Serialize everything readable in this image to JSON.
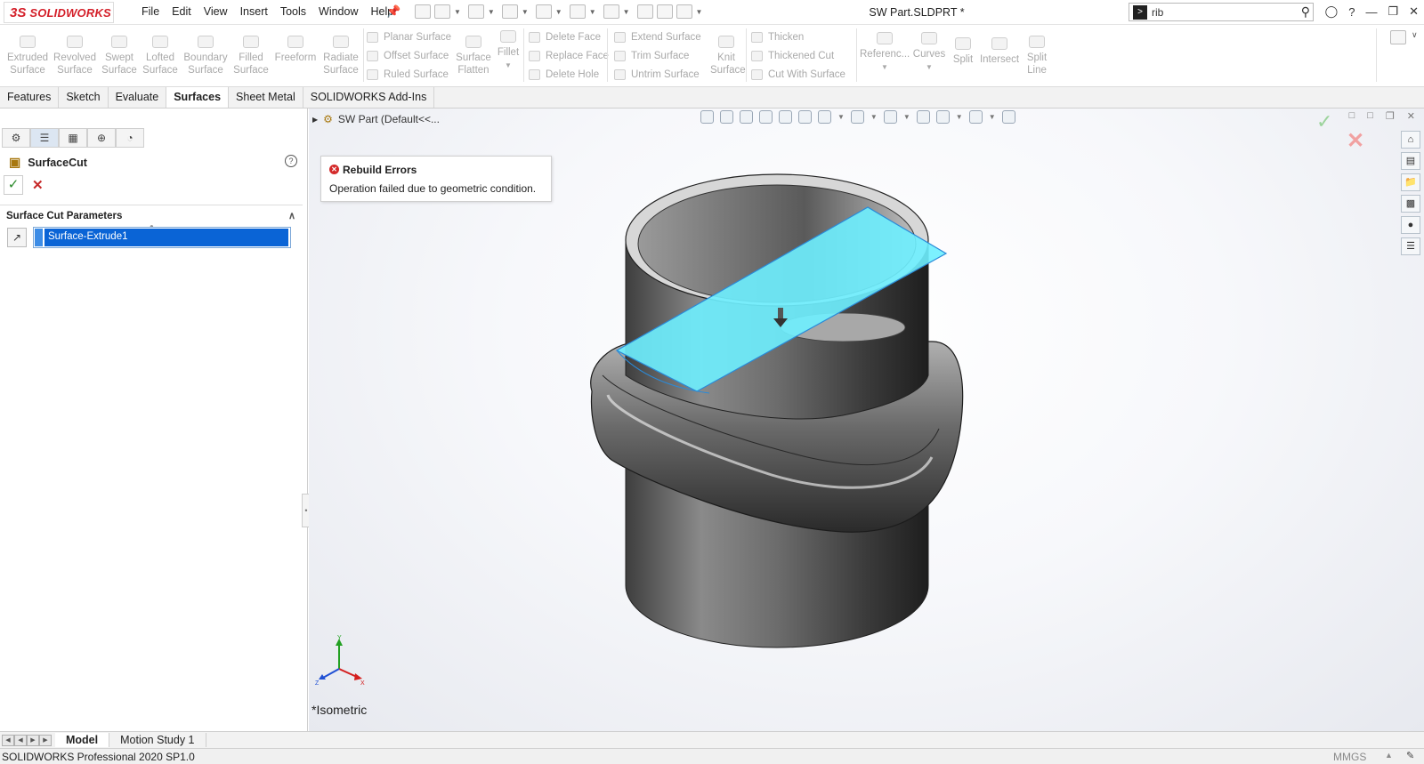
{
  "app": {
    "logo_prefix": "3S",
    "logo_text": "SOLIDWORKS",
    "document_title": "SW Part.SLDPRT *"
  },
  "menu": [
    "File",
    "Edit",
    "View",
    "Insert",
    "Tools",
    "Window",
    "Help"
  ],
  "search": {
    "value": "rib"
  },
  "ribbon": {
    "large_buttons": [
      {
        "label1": "Extruded",
        "label2": "Surface"
      },
      {
        "label1": "Revolved",
        "label2": "Surface"
      },
      {
        "label1": "Swept",
        "label2": "Surface"
      },
      {
        "label1": "Lofted",
        "label2": "Surface"
      },
      {
        "label1": "Boundary",
        "label2": "Surface"
      },
      {
        "label1": "Filled",
        "label2": "Surface"
      },
      {
        "label1": "Freeform",
        "label2": ""
      },
      {
        "label1": "Radiate",
        "label2": "Surface"
      }
    ],
    "group1": [
      "Planar Surface",
      "Offset Surface",
      "Ruled Surface"
    ],
    "flatten": {
      "label1": "Surface",
      "label2": "Flatten"
    },
    "fillet": "Fillet",
    "group2": [
      "Delete Face",
      "Replace Face",
      "Delete Hole"
    ],
    "group3": [
      "Extend Surface",
      "Trim Surface",
      "Untrim Surface"
    ],
    "knit": {
      "label1": "Knit",
      "label2": "Surface"
    },
    "group4": [
      "Thicken",
      "Thickened Cut",
      "Cut With Surface"
    ],
    "right_buttons": [
      {
        "label1": "Referenc...",
        "label2": ""
      },
      {
        "label1": "Curves",
        "label2": ""
      },
      {
        "label1": "Split",
        "label2": ""
      },
      {
        "label1": "Intersect",
        "label2": ""
      },
      {
        "label1": "Split",
        "label2": "Line"
      }
    ]
  },
  "command_tabs": [
    "Features",
    "Sketch",
    "Evaluate",
    "Surfaces",
    "Sheet Metal",
    "SOLIDWORKS Add-Ins"
  ],
  "active_tab": "Surfaces",
  "property_manager": {
    "title": "SurfaceCut",
    "help": "?",
    "group_title": "Surface Cut Parameters",
    "selection": "Surface-Extrude1"
  },
  "tree": {
    "root": "SW Part  (Default<<..."
  },
  "error": {
    "title": "Rebuild Errors",
    "message": "Operation failed due to geometric condition."
  },
  "view": {
    "name": "*Isometric"
  },
  "triad": {
    "x": "X",
    "y": "Y",
    "z": "Z"
  },
  "bottom_tabs": [
    "Model",
    "Motion Study 1"
  ],
  "status": {
    "left": "SOLIDWORKS Professional 2020 SP1.0",
    "units": "MMGS"
  },
  "colors": {
    "accent": "#d4202a",
    "selection": "#0a64d6",
    "surface": "#6ef0ff",
    "body": "#5a5a5a"
  }
}
